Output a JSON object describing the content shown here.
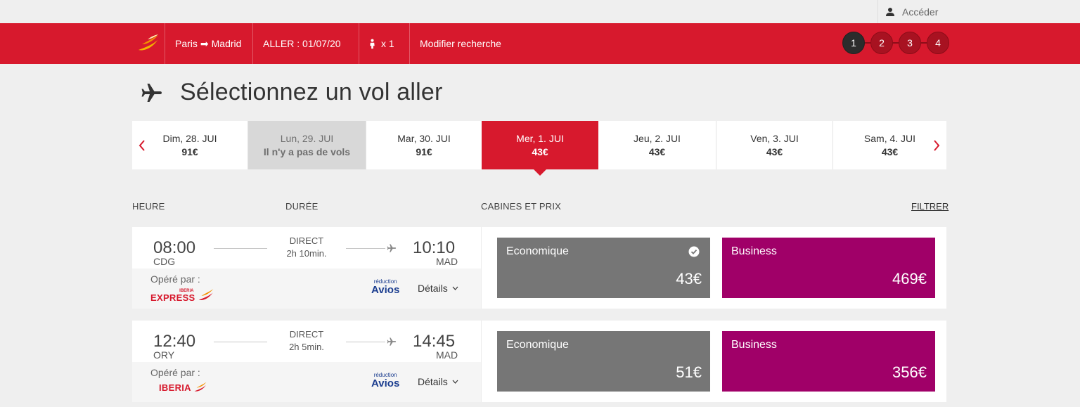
{
  "topbar": {
    "login_label": "Accéder",
    "login_icon": "user-icon"
  },
  "header": {
    "route_from": "Paris",
    "route_to": "Madrid",
    "outbound_label": "ALLER : 01/07/20",
    "passenger_count": "x 1",
    "passenger_icon": "person-icon",
    "modify_label": "Modifier recherche",
    "steps": [
      "1",
      "2",
      "3",
      "4"
    ],
    "active_step": "1",
    "brand_color": "#d7192d"
  },
  "page": {
    "title": "Sélectionnez un vol aller",
    "title_icon": "airplane-icon"
  },
  "dates": [
    {
      "day": "Dim, 28. JUI",
      "price": "91€",
      "state": "normal"
    },
    {
      "day": "Lun, 29. JUI",
      "price": "Il n'y a pas de vols",
      "state": "no-flights"
    },
    {
      "day": "Mar, 30. JUI",
      "price": "91€",
      "state": "normal"
    },
    {
      "day": "Mer, 1. JUI",
      "price": "43€",
      "state": "selected"
    },
    {
      "day": "Jeu, 2. JUI",
      "price": "43€",
      "state": "normal"
    },
    {
      "day": "Ven, 3. JUI",
      "price": "43€",
      "state": "normal"
    },
    {
      "day": "Sam, 4. JUI",
      "price": "43€",
      "state": "normal"
    }
  ],
  "columns": {
    "time": "HEURE",
    "duration": "DURÉE",
    "cabins": "CABINES ET PRIX",
    "filter": "FILTRER"
  },
  "flights": [
    {
      "dep_time": "08:00",
      "dep_airport": "CDG",
      "type": "DIRECT",
      "duration": "2h 10min.",
      "arr_time": "10:10",
      "arr_airport": "MAD",
      "operated_label": "Opéré par :",
      "operator_top": "IBERIA",
      "operator": "EXPRESS",
      "avios_top": "réduction",
      "avios": "Avios",
      "details_label": "Détails",
      "economy_label": "Economique",
      "economy_price": "43€",
      "economy_selected": true,
      "business_label": "Business",
      "business_price": "469€"
    },
    {
      "dep_time": "12:40",
      "dep_airport": "ORY",
      "type": "DIRECT",
      "duration": "2h 5min.",
      "arr_time": "14:45",
      "arr_airport": "MAD",
      "operated_label": "Opéré par :",
      "operator": "IBERIA",
      "avios_top": "réduction",
      "avios": "Avios",
      "details_label": "Détails",
      "economy_label": "Economique",
      "economy_price": "51€",
      "economy_selected": false,
      "business_label": "Business",
      "business_price": "356€"
    }
  ],
  "colors": {
    "economy": "#767676",
    "business": "#a00068",
    "no_flights": "#d8d8d8"
  }
}
